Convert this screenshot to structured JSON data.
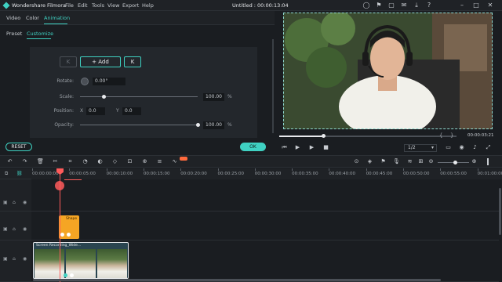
{
  "app": {
    "name": "Wondershare Filmora",
    "document_title": "Untitled : 00:00:13:04"
  },
  "menu": [
    "File",
    "Edit",
    "Tools",
    "View",
    "Export",
    "Help"
  ],
  "tabs": {
    "video": "Video",
    "color": "Color",
    "animation": "Animation"
  },
  "subtabs": {
    "preset": "Preset",
    "customize": "Customize"
  },
  "keyframe": {
    "prev_label": "K",
    "add_label": "+ Add",
    "next_label": "K"
  },
  "properties": {
    "rotate": {
      "label": "Rotate:",
      "value": "0.00°"
    },
    "scale": {
      "label": "Scale:",
      "value": "100.00",
      "unit": "%",
      "level": 0.2
    },
    "position": {
      "label": "Position:",
      "x_label": "X",
      "x_value": "0.0",
      "y_label": "Y",
      "y_value": "0.0"
    },
    "opacity": {
      "label": "Opacity:",
      "value": "100.00",
      "unit": "%",
      "level": 1.0
    }
  },
  "buttons": {
    "reset": "RESET",
    "ok": "OK"
  },
  "preview": {
    "timecode": "00:00:03:21",
    "quality": "1/2",
    "progress": 0.25,
    "bracket_left": "{",
    "bracket_right": "}"
  },
  "ruler": {
    "labels": [
      "00:00:00:00",
      "00:00:05:00",
      "00:00:10:00",
      "00:00:15:00",
      "00:00:20:00",
      "00:00:25:00",
      "00:00:30:00",
      "00:00:35:00",
      "00:00:40:00",
      "00:00:45:00",
      "00:00:50:00",
      "00:00:55:00",
      "00:01:00:00"
    ]
  },
  "tracks": {
    "orange_clip_label": "Shape",
    "video_clip_label": "Screen Recording_Wide..."
  },
  "colors": {
    "accent": "#3fd1c2",
    "playhead": "#ff5b5b",
    "clip_orange": "#f5a524"
  }
}
